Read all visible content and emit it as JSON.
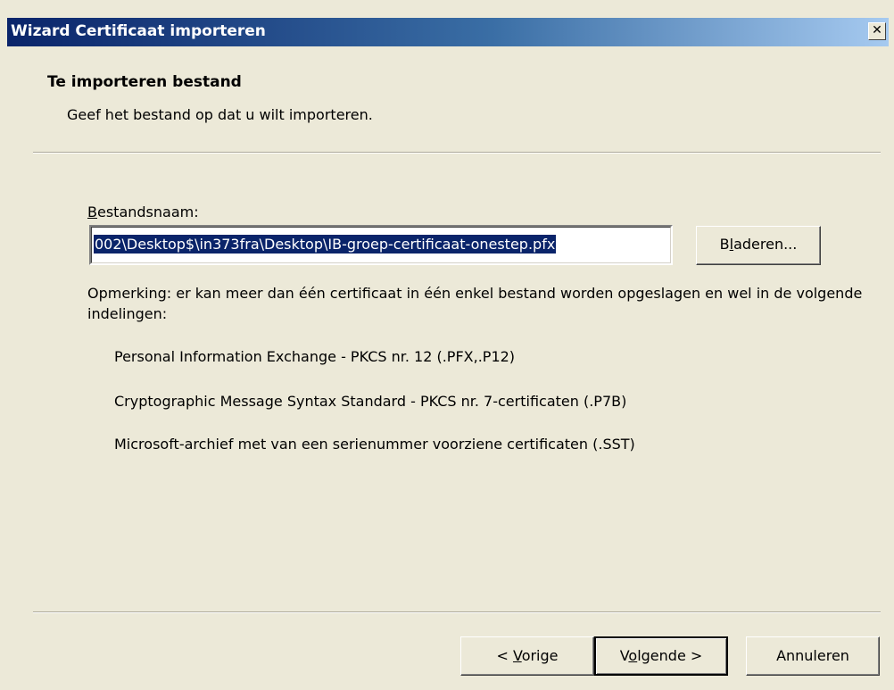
{
  "window": {
    "title": "Wizard Certificaat importeren",
    "close_glyph": "✕"
  },
  "header": {
    "title": "Te importeren bestand",
    "subtitle": "Geef het bestand op dat u wilt importeren."
  },
  "file": {
    "label_mnemonic": "B",
    "label_rest": "estandsnaam:",
    "value": "002\\Desktop$\\in373fra\\Desktop\\IB-groep-certificaat-onestep.pfx",
    "browse_pre": "B",
    "browse_mnemonic": "l",
    "browse_rest": "aderen..."
  },
  "note": {
    "text": "Opmerking: er kan meer dan één certificaat in één enkel bestand worden opgeslagen en wel in de volgende indelingen:"
  },
  "formats": [
    "Personal Information Exchange - PKCS nr. 12 (.PFX,.P12)",
    "Cryptographic Message Syntax Standard - PKCS nr. 7-certificaten (.P7B)",
    "Microsoft-archief met van een serienummer voorziene certificaten (.SST)"
  ],
  "footer": {
    "back_pre": "< ",
    "back_mnemonic": "V",
    "back_rest": "orige",
    "next_pre": "V",
    "next_mnemonic": "o",
    "next_rest": "lgende >",
    "cancel_label": "Annuleren"
  },
  "colors": {
    "title_gradient_start": "#0a246a",
    "title_gradient_end": "#a6caf0",
    "dialog_bg": "#ece9d8",
    "selection_bg": "#0a246a"
  }
}
